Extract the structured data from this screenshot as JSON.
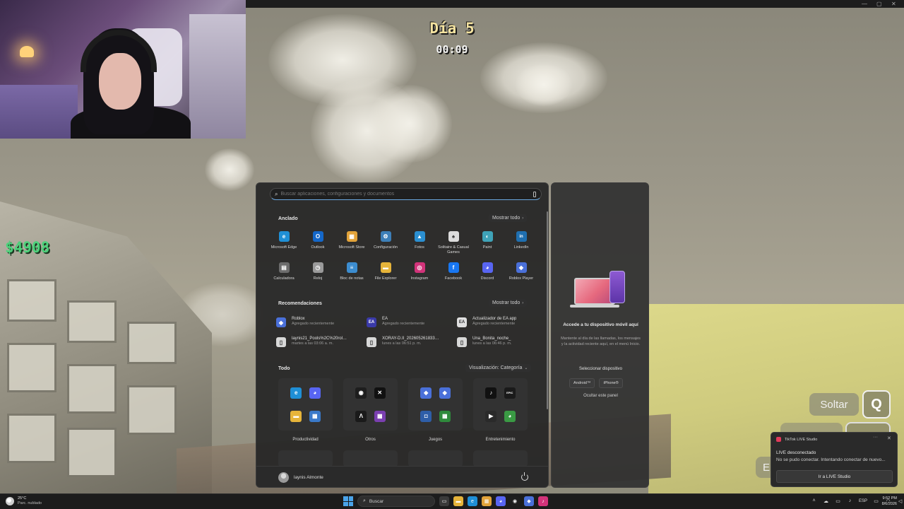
{
  "game": {
    "day_label": "Día 5",
    "timer": "00:09",
    "money": "$4908",
    "btn_drop": "Soltar",
    "key_q": "Q",
    "btn_e_partial": "E"
  },
  "start_menu": {
    "search_placeholder": "Buscar aplicaciones, configuraciones y documentos",
    "pinned_title": "Anclado",
    "pinned_more": "Mostrar todo",
    "pinned": [
      {
        "label": "Microsoft Edge",
        "icon": "edge-icon",
        "color": "#1f8fd6",
        "glyph": "e"
      },
      {
        "label": "Outlook",
        "icon": "outlook-icon",
        "color": "#1467c9",
        "glyph": "O"
      },
      {
        "label": "Microsoft Store",
        "icon": "store-icon",
        "color": "#e2a33a",
        "glyph": "▦"
      },
      {
        "label": "Configuración",
        "icon": "gear-icon",
        "color": "#3d7fb8",
        "glyph": "⚙"
      },
      {
        "label": "Fotos",
        "icon": "photos-icon",
        "color": "#2b8fd1",
        "glyph": "▲"
      },
      {
        "label": "Solitaire & Casual Games",
        "icon": "solitaire-icon",
        "color": "#dcdcdc",
        "glyph": "♠"
      },
      {
        "label": "Paint",
        "icon": "paint-icon",
        "color": "#3fa3b8",
        "glyph": "◐"
      },
      {
        "label": "LinkedIn",
        "icon": "linkedin-icon",
        "color": "#1f6fb0",
        "glyph": "in"
      },
      {
        "label": "Calculadora",
        "icon": "calculator-icon",
        "color": "#6c6c6c",
        "glyph": "▤"
      },
      {
        "label": "Reloj",
        "icon": "clock-icon",
        "color": "#9a9a9a",
        "glyph": "◷"
      },
      {
        "label": "Bloc de notas",
        "icon": "notepad-icon",
        "color": "#3c8dd0",
        "glyph": "≡"
      },
      {
        "label": "File Explorer",
        "icon": "folder-icon",
        "color": "#e6b43a",
        "glyph": "▬"
      },
      {
        "label": "Instagram",
        "icon": "instagram-icon",
        "color": "#d2337a",
        "glyph": "◎"
      },
      {
        "label": "Facebook",
        "icon": "facebook-icon",
        "color": "#1877f2",
        "glyph": "f"
      },
      {
        "label": "Discord",
        "icon": "discord-icon",
        "color": "#5865f2",
        "glyph": "◕"
      },
      {
        "label": "Roblox Player",
        "icon": "roblox-icon",
        "color": "#4a70d9",
        "glyph": "◆"
      }
    ],
    "rec_title": "Recomendaciones",
    "rec_more": "Mostrar todo",
    "recommendations": [
      {
        "name": "Roblox",
        "sub": "Agregado recientemente",
        "icon": "roblox-icon",
        "color": "#4a70d9",
        "glyph": "◆"
      },
      {
        "name": "EA",
        "sub": "Agregado recientemente",
        "icon": "ea-icon",
        "color": "#3a3aa8",
        "glyph": "EA"
      },
      {
        "name": "Actualizador de EA app",
        "sub": "Agregado recientemente",
        "icon": "ea-update-icon",
        "color": "#e0e0e0",
        "glyph": "EA"
      },
      {
        "name": "laynis21_Pools%2C%20rol%...",
        "sub": "martes a las 03:06 a. m.",
        "icon": "file-icon",
        "color": "#d8d8d8",
        "glyph": "▯"
      },
      {
        "name": "XORAY-D.II_20260526183306_...",
        "sub": "lunes a las 06:51 p. m.",
        "icon": "file-icon",
        "color": "#d8d8d8",
        "glyph": "▯"
      },
      {
        "name": "Una_Bonita_noche_",
        "sub": "lunes a las 06:46 p. m.",
        "icon": "file-icon",
        "color": "#d8d8d8",
        "glyph": "▯"
      }
    ],
    "all_title": "Todo",
    "view_label": "Visualización: Categoría",
    "categories": [
      {
        "label": "Productividad",
        "apps": [
          {
            "icon": "edge-icon",
            "color": "#1f8fd6",
            "glyph": "e"
          },
          {
            "icon": "discord-icon",
            "color": "#5865f2",
            "glyph": "◕"
          },
          {
            "icon": "folder-icon",
            "color": "#e6b43a",
            "glyph": "▬"
          },
          {
            "icon": "control-panel-icon",
            "color": "#3a79c9",
            "glyph": "▦"
          }
        ]
      },
      {
        "label": "Otros",
        "apps": [
          {
            "icon": "obs-icon",
            "color": "#1e1e1e",
            "glyph": "◉"
          },
          {
            "icon": "capcut-icon",
            "color": "#111111",
            "glyph": "✕"
          },
          {
            "icon": "app-dark-icon",
            "color": "#1a1a1a",
            "glyph": "Λ"
          },
          {
            "icon": "app-grid-icon",
            "color": "#7a3fb0",
            "glyph": "▦"
          }
        ]
      },
      {
        "label": "Juegos",
        "apps": [
          {
            "icon": "roblox-icon",
            "color": "#4a70d9",
            "glyph": "◆"
          },
          {
            "icon": "roblox-studio-icon",
            "color": "#4a70d9",
            "glyph": "◆"
          },
          {
            "icon": "gamepad-icon",
            "color": "#2e5ea8",
            "glyph": "◘"
          },
          {
            "icon": "xbox-icon",
            "color": "#2f8a3c",
            "glyph": "▦"
          }
        ]
      },
      {
        "label": "Entretenimiento",
        "apps": [
          {
            "icon": "tiktok-icon",
            "color": "#111111",
            "glyph": "♪"
          },
          {
            "icon": "epic-games-icon",
            "color": "#1a1a1a",
            "glyph": "EPIC"
          },
          {
            "icon": "media-player-icon",
            "color": "#2a2a2a",
            "glyph": "▶"
          },
          {
            "icon": "xbox-app-icon",
            "color": "#3a9a44",
            "glyph": "◕"
          }
        ]
      }
    ],
    "user_name": "laynis Almonte"
  },
  "phone_panel": {
    "title": "Accede a tu dispositivo móvil aquí",
    "desc": "Mantente al día de las llamadas, los mensajes y la actividad reciente aquí, en el menú Inicio.",
    "select": "Seleccionar dispositivo",
    "chip_android": "Android™",
    "chip_iphone": "iPhone®",
    "hide": "Ocultar este panel"
  },
  "toast": {
    "app": "TikTok LIVE Studio",
    "more": "···",
    "close": "✕",
    "title": "LIVE desconectado",
    "body": "No se pudo conectar. Intentando conectar de nuevo...",
    "button": "Ir a LIVE Studio"
  },
  "taskbar": {
    "temp": "25°C",
    "condition": "Parc. nublado",
    "search": "Buscar",
    "lang": "ESP",
    "time": "9:52 PM",
    "date": "8/6/2026"
  }
}
